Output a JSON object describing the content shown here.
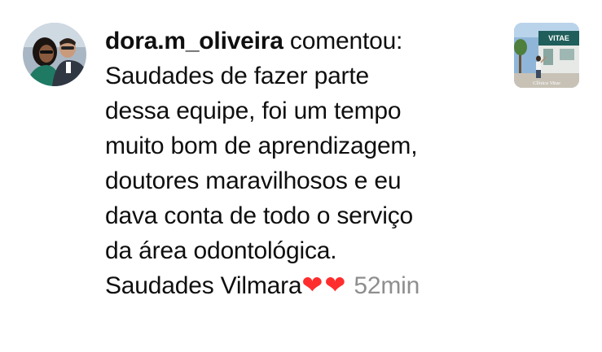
{
  "notification": {
    "username": "dora.m_oliveira",
    "action": "comentou:",
    "comment_lines": [
      "Saudades de fazer parte",
      "dessa equipe, foi um tempo",
      "muito bom de aprendizagem,",
      "doutores maravilhosos e eu",
      "dava conta de todo o serviço",
      "da área odontológica."
    ],
    "last_line_text": "Saudades Vilmara",
    "hearts": "❤❤",
    "time": "52min"
  },
  "post_thumbnail": {
    "sign_text": "VITAE",
    "caption": "Clínica Vitae"
  },
  "icons": {
    "avatar": "profile-avatar",
    "heart": "heart-emoji"
  },
  "colors": {
    "heart": "#ff2d2d",
    "time": "#8e8e8e",
    "text": "#0f0f0f"
  }
}
